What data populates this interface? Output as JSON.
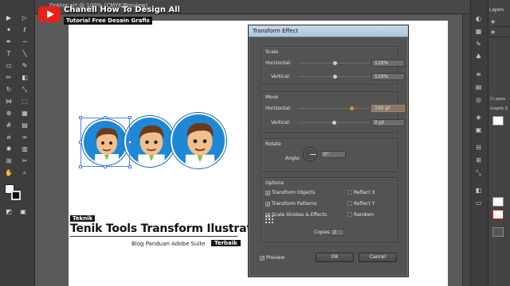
{
  "brand": {
    "channel_title": "Chanell How To Design All",
    "channel_subtitle": "Tutorial Free Desain Grafis",
    "accent": "#e62117"
  },
  "document": {
    "tab_label": "Doktor.ai* @ 100% (CMYK/Preview)"
  },
  "caption": {
    "tag": "Teknik",
    "title": "Tenik Tools Transform Ilustrator",
    "blog": "Blog Panduan Adobe Suite",
    "badge": "Terbaik"
  },
  "dialog": {
    "title": "Transform Effect",
    "scale": {
      "label": "Scale",
      "horizontal_label": "Horizontal:",
      "horizontal_value": "110%",
      "vertical_label": "Vertical:",
      "vertical_value": "110%",
      "horizontal_level": 0.52,
      "vertical_level": 0.52
    },
    "move": {
      "label": "Move",
      "horizontal_label": "Horizontal:",
      "horizontal_value": "100 pt",
      "vertical_label": "Vertical:",
      "vertical_value": "0 pt",
      "horizontal_level": 0.75,
      "vertical_level": 0.5
    },
    "rotate": {
      "label": "Rotate",
      "angle_label": "Angle:",
      "angle_value": "0°"
    },
    "options": {
      "label": "Options",
      "transform_objects": "Transform Objects",
      "transform_patterns": "Transform Patterns",
      "scale_strokes": "Scale Strokes & Effects",
      "reflect_x": "Reflect X",
      "reflect_y": "Reflect Y",
      "random": "Random",
      "copies_label": "Copies",
      "copies_value": "2"
    },
    "preview_label": "Preview",
    "ok_label": "OK",
    "cancel_label": "Cancel"
  },
  "panels": {
    "layers_tab": "Layers",
    "layers_count": "2 Layers",
    "graphic_tab": "Graphic S"
  },
  "icons": {
    "youtube": "youtube-play-icon",
    "dial": "angle-dial-icon",
    "reference_point": "reference-point-icon"
  }
}
